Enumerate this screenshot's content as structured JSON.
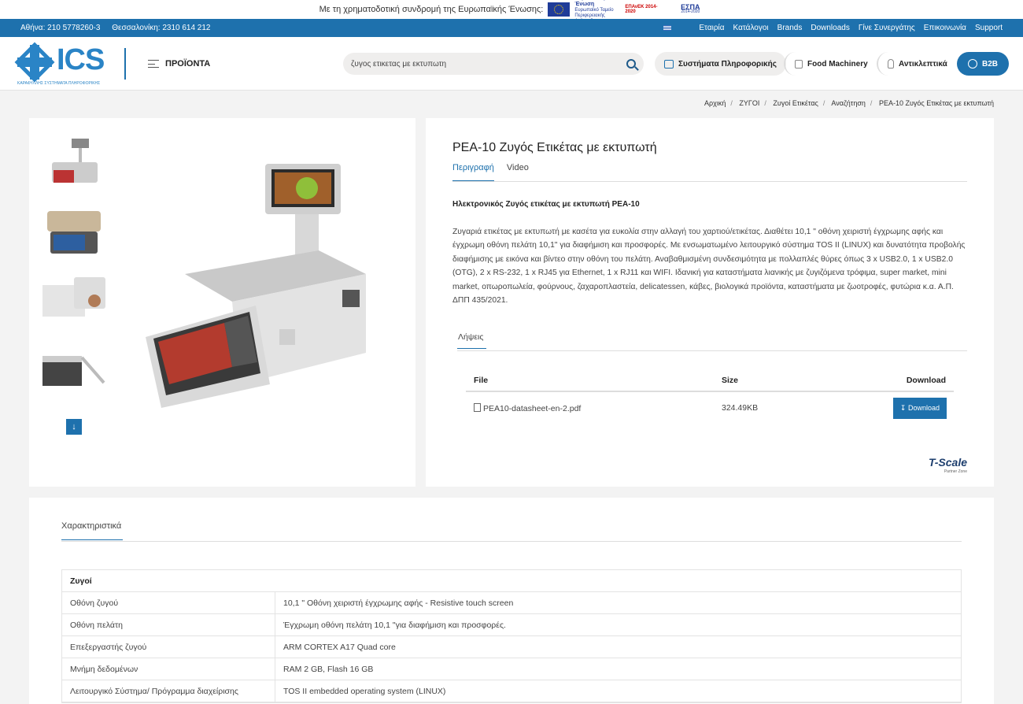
{
  "top_strip": {
    "caption": "Με τη χρηματοδοτική συνδρομή της Ευρωπαϊκής Ένωσης:",
    "eu_logo_text": "Ευρωπαϊκή Ένωση",
    "eu_logo_sub": "Ευρωπαϊκό Ταμείο Περιφερειακής Ανάπτυξης",
    "epanek_text": "ΕΠΑνΕΚ 2014-2020",
    "espa_text": "ΕΣΠΑ",
    "espa_sub": "2014-2020"
  },
  "topbar": {
    "phone_athens": "Αθήνα: 210 5778260-3",
    "phone_thess": "Θεσσαλονίκη: 2310 614 212",
    "nav": [
      "Εταιρία",
      "Κατάλογοι",
      "Brands",
      "Downloads",
      "Γίνε Συνεργάτης",
      "Επικοινωνία",
      "Support"
    ]
  },
  "header": {
    "logo_name": "ICS",
    "logo_sub": "ΚΑΡΑΦΥΛΛΗΣ ΣΥΣΤΗΜΑΤΑ ΠΛΗΡΟΦΟΡΙΚΗΣ",
    "products_label": "ΠΡΟΪΟΝΤΑ",
    "search_value": "ζυγος ετικετας με εκτυπωτη",
    "pill_it": "Συστήματα Πληροφορικής",
    "pill_food": "Food Machinery",
    "pill_anti": "Αντικλεπτικά",
    "b2b": "B2B"
  },
  "breadcrumb": [
    "Αρχική",
    "ΖΥΓΟΙ",
    "Ζυγοί Ετικέτας",
    "Αναζήτηση",
    "PEA-10 Ζυγός Ετικέτας με εκτυπωτή"
  ],
  "product": {
    "title": "PEA-10 Ζυγός Ετικέτας με εκτυπωτή",
    "tabs": [
      "Περιγραφή",
      "Video"
    ],
    "subtitle": "Ηλεκτρονικός Ζυγός ετικέτας με εκτυπωτή PEA-10",
    "description": "Ζυγαριά ετικέτας με εκτυπωτή με κασέτα για ευκολία στην αλλαγή του χαρτιού/ετικέτας. Διαθέτει 10,1 \" οθόνη χειριστή έγχρωμης αφής και έγχρωμη οθόνη πελάτη 10,1\" για διαφήμιση και προσφορές. Με ενσωματωμένο λειτουργικό σύστημα TOS II (LINUX) και δυνατότητα προβολής διαφήμισης με εικόνα και βίντεο στην οθόνη του πελάτη. Αναβαθμισμένη συνδεσιμότητα με πολλαπλές θύρες όπως 3 x USB2.0, 1 x USB2.0 (OTG), 2 x RS-232, 1 x RJ45 για Ethernet, 1 x RJ11 και WIFI. Ιδανική για καταστήματα λιανικής με ζυγιζόμενα τρόφιμα, super market, mini market, οπωροπωλεία, φούρνους, ζαχαροπλαστεία, delicatessen, κάβες, βιολογικά προϊόντα, καταστήματα με ζωοτροφές, φυτώρια κ.α. Α.Π. ΔΠΠ 435/2021.",
    "downloads_tab": "Λήψεις",
    "downloads": {
      "headers": {
        "file": "File",
        "size": "Size",
        "download": "Download"
      },
      "rows": [
        {
          "file": "PEA10-datasheet-en-2.pdf",
          "size": "324.49KB",
          "button": "Download"
        }
      ]
    },
    "partner_logo": "T-Scale",
    "partner_sub": "Partner Zone"
  },
  "features": {
    "tab": "Χαρακτηριστικά",
    "group": "Ζυγοί",
    "rows": [
      {
        "k": "Οθόνη ζυγού",
        "v": "10,1 \" Οθόνη χειριστή έγχρωμης αφής - Resistive touch screen"
      },
      {
        "k": "Οθόνη πελάτη",
        "v": "Έγχρωμη οθόνη πελάτη 10,1 \"για διαφήμιση και προσφορές."
      },
      {
        "k": "Επεξεργαστής ζυγού",
        "v": "ARM CORTEX A17 Quad core"
      },
      {
        "k": "Μνήμη δεδομένων",
        "v": "RAM 2 GB, Flash 16 GB"
      },
      {
        "k": "Λειτουργικό Σύστημα/ Πρόγραμμα διαχείρισης",
        "v": "TOS II embedded operating system (LINUX)"
      }
    ]
  },
  "colors": {
    "brand": "#1e71ad",
    "logo": "#2a84c6"
  }
}
